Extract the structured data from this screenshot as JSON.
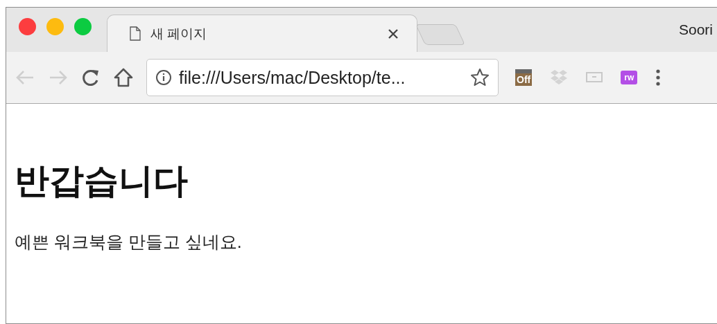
{
  "window": {
    "profile": "Soori"
  },
  "tabs": [
    {
      "title": "새 페이지",
      "selected": true
    }
  ],
  "toolbar": {
    "back": {
      "disabled": true
    },
    "forward": {
      "disabled": true
    },
    "address": {
      "value": "file:///Users/mac/Desktop/te..."
    },
    "extensions": [
      {
        "kind": "off-badge",
        "label": "Off"
      },
      {
        "kind": "dropbox"
      },
      {
        "kind": "cast"
      },
      {
        "kind": "puzzle",
        "label": "rw"
      }
    ]
  },
  "page": {
    "heading": "반갑습니다",
    "paragraph": "예쁜 워크북을 만들고 싶네요."
  }
}
